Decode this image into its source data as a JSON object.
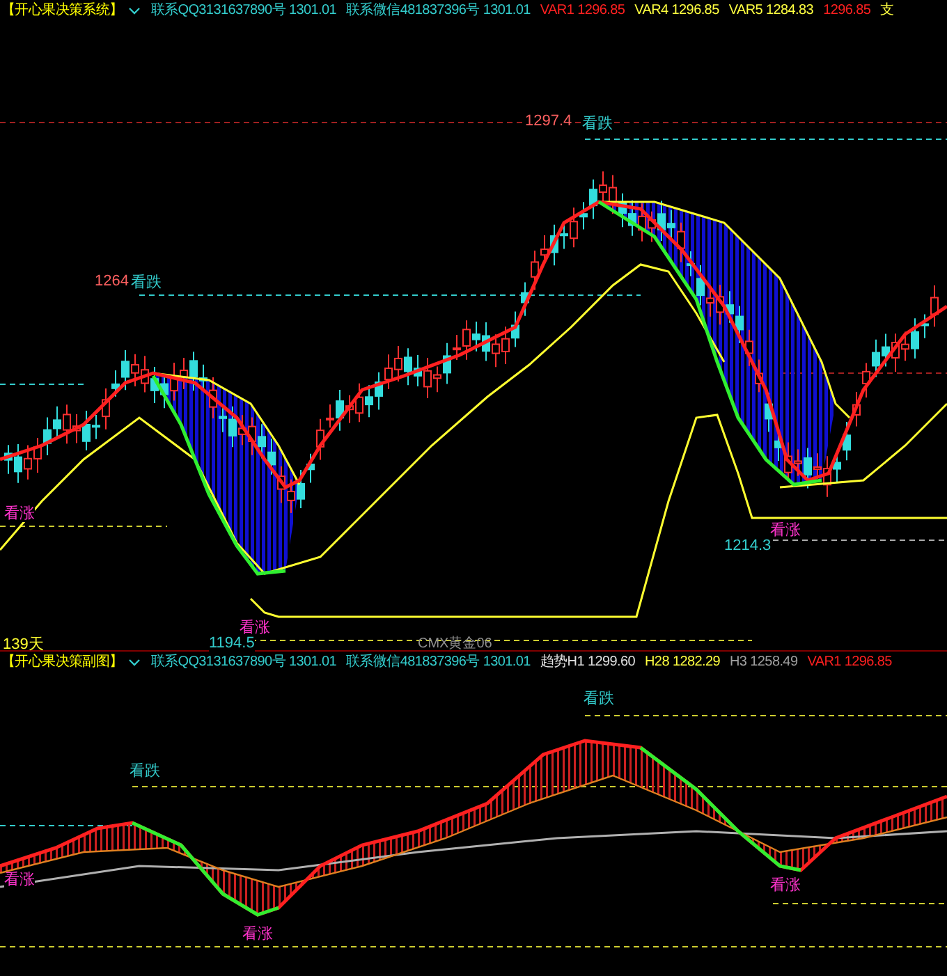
{
  "main_panel": {
    "header": [
      {
        "text": "【开心果决策系统】",
        "color": "#ffff00"
      },
      {
        "text": "联系QQ3131637890号 1301.01",
        "color": "#33cccc"
      },
      {
        "text": "联系微信481837396号 1301.01",
        "color": "#33cccc"
      },
      {
        "text": "VAR1 1296.85",
        "color": "#ff2020"
      },
      {
        "text": "VAR4 1296.85",
        "color": "#ffff40"
      },
      {
        "text": "VAR5 1284.83",
        "color": "#ffff40"
      },
      {
        "text": "1296.85",
        "color": "#ff2020"
      },
      {
        "text": "支",
        "color": "#ffff40"
      }
    ],
    "chart_labels": [
      {
        "text": "1297.4",
        "color": "#ff6060"
      },
      {
        "text": "看跌",
        "color": "#33cccc"
      },
      {
        "text": "1264",
        "color": "#ff6060"
      },
      {
        "text": "看跌",
        "color": "#33cccc"
      },
      {
        "text": "看涨",
        "color": "#ff33cc"
      },
      {
        "text": "1194.5",
        "color": "#33cccc"
      },
      {
        "text": "看涨",
        "color": "#ff33cc"
      },
      {
        "text": "1214.3",
        "color": "#33cccc"
      },
      {
        "text": "看涨",
        "color": "#ff33cc"
      }
    ],
    "period": "139天",
    "instrument": "CMX黄金06"
  },
  "sub_panel": {
    "header": [
      {
        "text": "【开心果决策副图】",
        "color": "#ffff00"
      },
      {
        "text": "联系QQ3131637890号 1301.01",
        "color": "#33cccc"
      },
      {
        "text": "联系微信481837396号 1301.01",
        "color": "#33cccc"
      },
      {
        "text": "趋势H1 1299.60",
        "color": "#e0e0e0"
      },
      {
        "text": "H28 1282.29",
        "color": "#ffff40"
      },
      {
        "text": "H3 1258.49",
        "color": "#a0a0a0"
      },
      {
        "text": "VAR1 1296.85",
        "color": "#ff2020"
      }
    ],
    "chart_labels": [
      {
        "text": "看跌",
        "color": "#33cccc"
      },
      {
        "text": "看跌",
        "color": "#33cccc"
      },
      {
        "text": "看涨",
        "color": "#ff33cc"
      },
      {
        "text": "看涨",
        "color": "#ff33cc"
      },
      {
        "text": "看涨",
        "color": "#ff33cc"
      }
    ]
  }
}
